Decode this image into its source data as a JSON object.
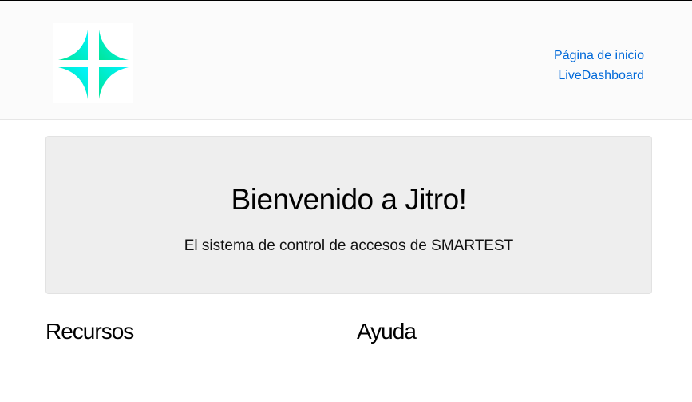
{
  "header": {
    "logo": {
      "icon": "jitro-logo-icon",
      "gradient": [
        "#00e5c0",
        "#00f2ff"
      ]
    },
    "nav": [
      {
        "label": "Página de inicio"
      },
      {
        "label": "LiveDashboard"
      }
    ],
    "link_color": "#0069d9"
  },
  "hero": {
    "title": "Bienvenido a Jitro!",
    "subtitle": "El sistema de control de accesos de SMARTEST"
  },
  "sections": {
    "resources_title": "Recursos",
    "help_title": "Ayuda"
  }
}
